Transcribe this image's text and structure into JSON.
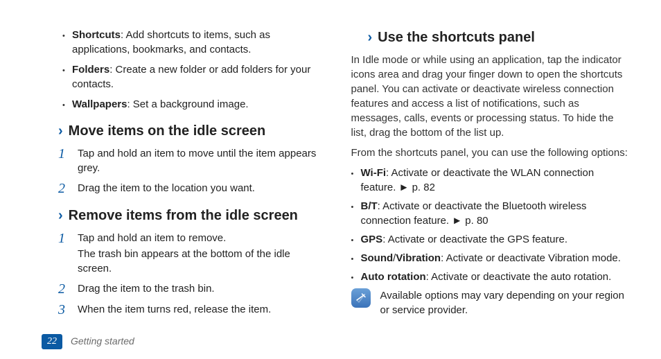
{
  "left": {
    "subBullets": [
      {
        "label": "Shortcuts",
        "desc": ": Add shortcuts to items, such as applications, bookmarks, and contacts."
      },
      {
        "label": "Folders",
        "desc": ": Create a new folder or add folders for your contacts."
      },
      {
        "label": "Wallpapers",
        "desc": ": Set a background image."
      }
    ],
    "sections": [
      {
        "title": "Move items on the idle screen",
        "steps": [
          {
            "num": "1",
            "text": "Tap and hold an item to move until the item appears grey."
          },
          {
            "num": "2",
            "text": "Drag the item to the location you want."
          }
        ]
      },
      {
        "title": "Remove items from the idle screen",
        "steps": [
          {
            "num": "1",
            "text": "Tap and hold an item to remove.",
            "text2": "The trash bin appears at the bottom of the idle screen."
          },
          {
            "num": "2",
            "text": "Drag the item to the trash bin."
          },
          {
            "num": "3",
            "text": "When the item turns red, release the item."
          }
        ]
      }
    ]
  },
  "right": {
    "title": "Use the shortcuts panel",
    "intro": "In Idle mode or while using an application, tap the indicator icons area and drag your finger down to open the shortcuts panel. You can activate or deactivate wireless connection features and access a list of notifications, such as messages, calls, events or processing status. To hide the list, drag the bottom of the list up.",
    "lead": "From the shortcuts panel, you can use the following options:",
    "bullets": [
      {
        "label": "Wi-Fi",
        "desc": ": Activate or deactivate the WLAN connection feature. ",
        "ref": "p. 82"
      },
      {
        "label": "B/T",
        "desc": ": Activate or deactivate the Bluetooth wireless connection feature. ",
        "ref": "p. 80"
      },
      {
        "label": "GPS",
        "desc": ": Activate or deactivate the GPS feature."
      },
      {
        "label": "Sound",
        "label2": "Vibration",
        "desc": ": Activate or deactivate Vibration mode."
      },
      {
        "label": "Auto rotation",
        "desc": ": Activate or deactivate the auto rotation."
      }
    ],
    "note": "Available options may vary depending on your region or service provider."
  },
  "footer": {
    "page": "22",
    "chapter": "Getting started"
  }
}
